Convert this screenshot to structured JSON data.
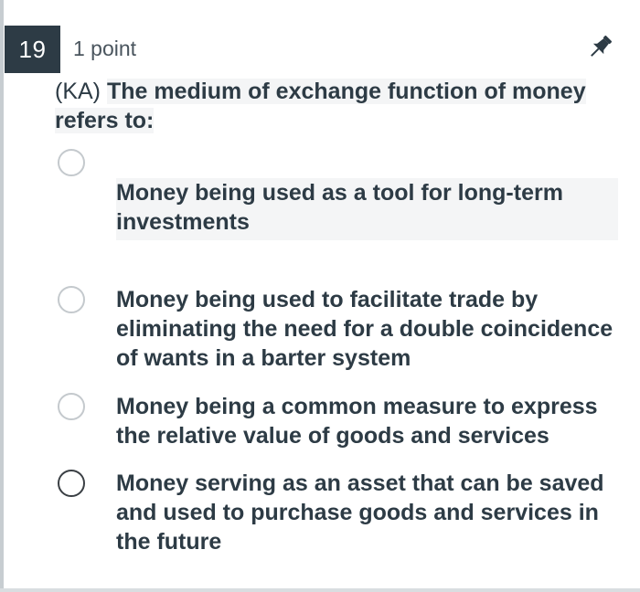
{
  "question": {
    "number": "19",
    "points_label": "1 point",
    "prefix": "(KA)",
    "text": "The medium of exchange function of money refers to:"
  },
  "options": [
    {
      "label": "Money being used as a tool for long-term investments",
      "selected": false
    },
    {
      "label": "Money being used to facilitate trade by eliminating the need for a double coincidence of wants in a barter system",
      "selected": false
    },
    {
      "label": "Money being a common measure to express the relative value of goods and services",
      "selected": false
    },
    {
      "label": "Money serving as an asset that can be saved and used to purchase goods and services in the future",
      "selected": false
    }
  ],
  "icons": {
    "pin": "pushpin-icon",
    "radio": "radio-unselected-icon"
  },
  "colors": {
    "question_badge_bg": "#2d3b45",
    "text": "#2d3b45",
    "highlight": "#f4f5f6"
  }
}
